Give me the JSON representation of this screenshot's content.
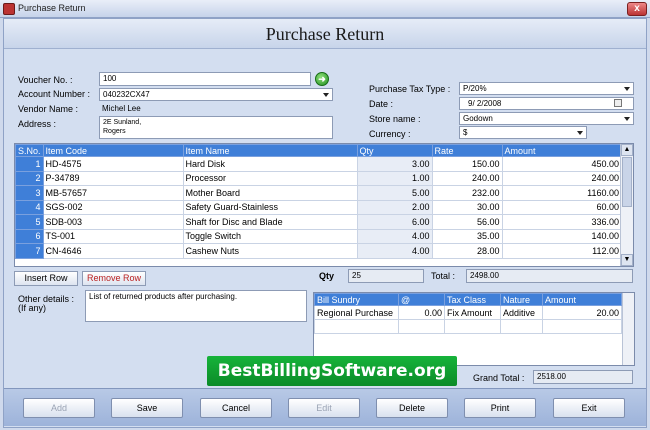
{
  "window": {
    "title": "Purchase Return",
    "close": "x"
  },
  "header": {
    "title": "Purchase Return"
  },
  "form": {
    "voucher_label": "Voucher No. :",
    "voucher_value": "100",
    "account_label": "Account Number :",
    "account_value": "040232CX47",
    "vendor_label": "Vendor Name :",
    "vendor_value": "Michel Lee",
    "address_label": "Address :",
    "address_line1": "2E Sunland,",
    "address_line2": "Rogers",
    "tax_label": "Purchase Tax Type :",
    "tax_value": "P/20%",
    "date_label": "Date :",
    "date_value": "9/  2/2008",
    "store_label": "Store name :",
    "store_value": "Godown",
    "currency_label": "Currency :",
    "currency_value": "$"
  },
  "items": {
    "columns": [
      "S.No.",
      "Item Code",
      "Item Name",
      "Qty",
      "Rate",
      "Amount"
    ],
    "rows": [
      [
        "1",
        "HD-4575",
        "Hard Disk",
        "3.00",
        "150.00",
        "450.00"
      ],
      [
        "2",
        "P-34789",
        "Processor",
        "1.00",
        "240.00",
        "240.00"
      ],
      [
        "3",
        "MB-57657",
        "Mother Board",
        "5.00",
        "232.00",
        "1160.00"
      ],
      [
        "4",
        "SGS-002",
        "Safety Guard-Stainless",
        "2.00",
        "30.00",
        "60.00"
      ],
      [
        "5",
        "SDB-003",
        "Shaft for Disc and Blade",
        "6.00",
        "56.00",
        "336.00"
      ],
      [
        "6",
        "TS-001",
        "Toggle Switch",
        "4.00",
        "35.00",
        "140.00"
      ],
      [
        "7",
        "CN-4646",
        "Cashew Nuts",
        "4.00",
        "28.00",
        "112.00"
      ]
    ]
  },
  "actions": {
    "insert_row": "Insert Row",
    "remove_row": "Remove Row"
  },
  "totals": {
    "qty_label": "Qty",
    "qty_value": "25",
    "total_label": "Total :",
    "total_value": "2498.00",
    "grand_label": "Grand Total :",
    "grand_value": "2518.00"
  },
  "other": {
    "label_line1": "Other details :",
    "label_line2": "(If any)",
    "value": "List of returned products after purchasing."
  },
  "sundry": {
    "columns": [
      "Bill Sundry",
      "@",
      "Tax Class",
      "Nature",
      "Amount"
    ],
    "rows": [
      [
        "Regional Purchase",
        "0.00",
        "Fix Amount",
        "Additive",
        "20.00"
      ]
    ]
  },
  "banner": {
    "text": "BestBillingSoftware.org"
  },
  "buttons": {
    "add": "Add",
    "save": "Save",
    "cancel": "Cancel",
    "edit": "Edit",
    "delete": "Delete",
    "print": "Print",
    "exit": "Exit"
  }
}
